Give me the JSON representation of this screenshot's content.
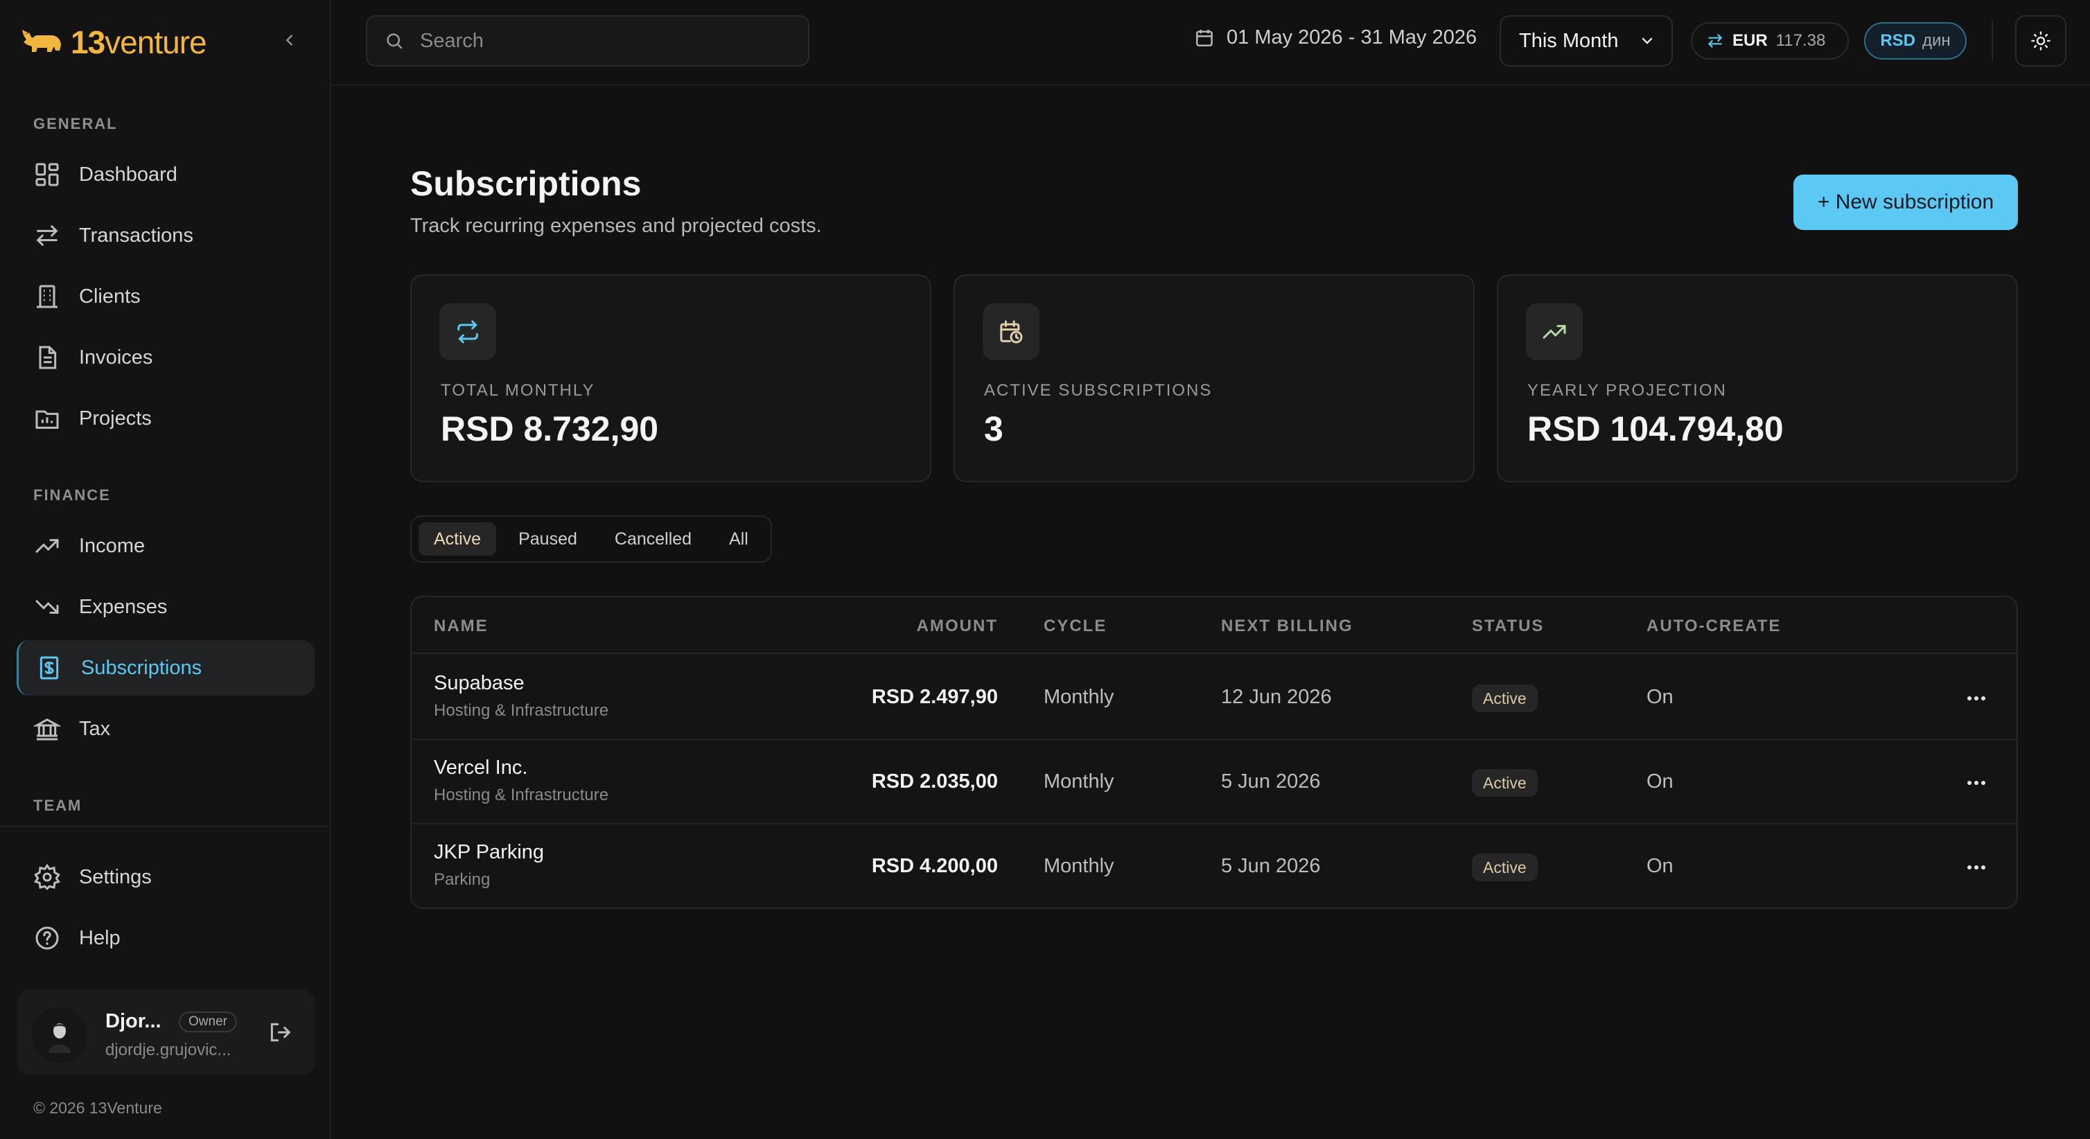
{
  "app": {
    "logo_number": "13",
    "logo_word": "venture",
    "brand_color": "#f2b53d",
    "accent_color": "#5cc8f4"
  },
  "sidebar": {
    "sections": {
      "general": "GENERAL",
      "finance": "FINANCE",
      "team": "TEAM"
    },
    "items": [
      {
        "label": "Dashboard",
        "icon": "grid-icon"
      },
      {
        "label": "Transactions",
        "icon": "arrows-swap-icon"
      },
      {
        "label": "Clients",
        "icon": "building-icon"
      },
      {
        "label": "Invoices",
        "icon": "document-icon"
      },
      {
        "label": "Projects",
        "icon": "folder-chart-icon"
      },
      {
        "label": "Income",
        "icon": "trend-up-icon"
      },
      {
        "label": "Expenses",
        "icon": "trend-down-icon"
      },
      {
        "label": "Subscriptions",
        "icon": "dollar-file-icon",
        "active": true
      },
      {
        "label": "Tax",
        "icon": "bank-icon"
      },
      {
        "label": "Settings",
        "icon": "gear-icon"
      },
      {
        "label": "Help",
        "icon": "question-circle-icon"
      }
    ],
    "user": {
      "name": "Djor...",
      "role": "Owner",
      "email": "djordje.grujovic..."
    },
    "copyright": "© 2026 13Venture"
  },
  "topbar": {
    "search_placeholder": "Search",
    "date_range": "01 May 2026 - 31 May 2026",
    "period": "This Month",
    "fx_currency": "EUR",
    "fx_rate": "117.38",
    "base_currency": "RSD",
    "base_symbol": "дин"
  },
  "page": {
    "title": "Subscriptions",
    "subtitle": "Track recurring expenses and projected costs.",
    "new_button": "+ New subscription"
  },
  "stats": [
    {
      "label": "TOTAL MONTHLY",
      "value": "RSD 8.732,90",
      "icon": "repeat-icon"
    },
    {
      "label": "ACTIVE SUBSCRIPTIONS",
      "value": "3",
      "icon": "calendar-clock-icon"
    },
    {
      "label": "YEARLY PROJECTION",
      "value": "RSD 104.794,80",
      "icon": "trend-up-icon"
    }
  ],
  "tabs": [
    "Active",
    "Paused",
    "Cancelled",
    "All"
  ],
  "table": {
    "columns": [
      "NAME",
      "AMOUNT",
      "CYCLE",
      "NEXT BILLING",
      "STATUS",
      "AUTO-CREATE"
    ],
    "rows": [
      {
        "name": "Supabase",
        "category": "Hosting & Infrastructure",
        "amount": "RSD 2.497,90",
        "cycle": "Monthly",
        "next": "12 Jun 2026",
        "status": "Active",
        "auto": "On"
      },
      {
        "name": "Vercel Inc.",
        "category": "Hosting & Infrastructure",
        "amount": "RSD 2.035,00",
        "cycle": "Monthly",
        "next": "5 Jun 2026",
        "status": "Active",
        "auto": "On"
      },
      {
        "name": "JKP Parking",
        "category": "Parking",
        "amount": "RSD 4.200,00",
        "cycle": "Monthly",
        "next": "5 Jun 2026",
        "status": "Active",
        "auto": "On"
      }
    ]
  }
}
